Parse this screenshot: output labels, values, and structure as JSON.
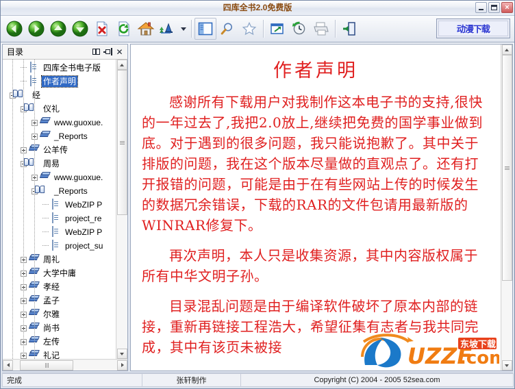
{
  "window": {
    "title": "四库全书2.0免费版",
    "minimize_label": "最小化",
    "maximize_label": "最大化",
    "close_label": "×"
  },
  "toolbar": {
    "buttons": [
      {
        "name": "back",
        "icon": "back-arrow-icon",
        "tooltip": "后退"
      },
      {
        "name": "forward",
        "icon": "forward-arrow-icon",
        "tooltip": "前进"
      },
      {
        "name": "up",
        "icon": "up-arrow-icon",
        "tooltip": "上一个"
      },
      {
        "name": "down",
        "icon": "down-arrow-icon",
        "tooltip": "下一个"
      },
      {
        "name": "stop",
        "icon": "stop-page-icon",
        "tooltip": "停止"
      },
      {
        "name": "refresh",
        "icon": "refresh-icon",
        "tooltip": "刷新"
      },
      {
        "name": "home",
        "icon": "home-icon",
        "tooltip": "主页"
      },
      {
        "name": "font",
        "icon": "font-size-icon",
        "tooltip": "字体"
      },
      {
        "name": "font-dropdown",
        "icon": "chevron-down-icon",
        "tooltip": "更多"
      },
      {
        "name": "contents",
        "icon": "contents-panel-icon",
        "tooltip": "目录"
      },
      {
        "name": "search",
        "icon": "magnifier-icon",
        "tooltip": "搜索"
      },
      {
        "name": "favorites",
        "icon": "star-icon",
        "tooltip": "收藏"
      },
      {
        "name": "open-window",
        "icon": "open-in-window-icon",
        "tooltip": "新窗口"
      },
      {
        "name": "history",
        "icon": "history-clock-icon",
        "tooltip": "历史"
      },
      {
        "name": "print",
        "icon": "printer-icon",
        "tooltip": "打印"
      },
      {
        "name": "exit",
        "icon": "exit-door-icon",
        "tooltip": "退出"
      }
    ],
    "download_button_label": "动漫下载"
  },
  "sidebar": {
    "panel_title": "目录",
    "header_buttons": [
      {
        "name": "dock-layout",
        "icon": "split-panel-icon"
      },
      {
        "name": "auto-hide",
        "icon": "pin-icon"
      },
      {
        "name": "close-panel",
        "icon": "close-icon",
        "label": "✕"
      }
    ],
    "tree": [
      {
        "label": "四库全书电子版",
        "depth": 1,
        "icon": "page-icon",
        "expander": "none",
        "selected": false
      },
      {
        "label": "作者声明",
        "depth": 1,
        "icon": "page-icon",
        "expander": "none",
        "selected": true
      },
      {
        "label": "经",
        "depth": 0,
        "icon": "openbook-icon",
        "expander": "minus",
        "selected": false
      },
      {
        "label": "仪礼",
        "depth": 1,
        "icon": "openbook-icon",
        "expander": "minus",
        "selected": false
      },
      {
        "label": "www.guoxue.",
        "depth": 2,
        "icon": "book-icon",
        "expander": "plus",
        "selected": false
      },
      {
        "label": "_Reports",
        "depth": 2,
        "icon": "book-icon",
        "expander": "plus",
        "selected": false
      },
      {
        "label": "公羊传",
        "depth": 1,
        "icon": "book-icon",
        "expander": "plus",
        "selected": false
      },
      {
        "label": "周易",
        "depth": 1,
        "icon": "openbook-icon",
        "expander": "minus",
        "selected": false
      },
      {
        "label": "www.guoxue.",
        "depth": 2,
        "icon": "book-icon",
        "expander": "plus",
        "selected": false
      },
      {
        "label": "_Reports",
        "depth": 2,
        "icon": "openbook-icon",
        "expander": "minus",
        "selected": false
      },
      {
        "label": "WebZIP P",
        "depth": 3,
        "icon": "page-icon",
        "expander": "none",
        "selected": false
      },
      {
        "label": "project_re",
        "depth": 3,
        "icon": "page-icon",
        "expander": "none",
        "selected": false
      },
      {
        "label": "WebZIP P",
        "depth": 3,
        "icon": "page-icon",
        "expander": "none",
        "selected": false
      },
      {
        "label": "project_su",
        "depth": 3,
        "icon": "page-icon",
        "expander": "none",
        "selected": false
      },
      {
        "label": "周礼",
        "depth": 1,
        "icon": "book-icon",
        "expander": "plus",
        "selected": false
      },
      {
        "label": "大学中庸",
        "depth": 1,
        "icon": "book-icon",
        "expander": "plus",
        "selected": false
      },
      {
        "label": "孝经",
        "depth": 1,
        "icon": "book-icon",
        "expander": "plus",
        "selected": false
      },
      {
        "label": "孟子",
        "depth": 1,
        "icon": "book-icon",
        "expander": "plus",
        "selected": false
      },
      {
        "label": "尔雅",
        "depth": 1,
        "icon": "book-icon",
        "expander": "plus",
        "selected": false
      },
      {
        "label": "尚书",
        "depth": 1,
        "icon": "book-icon",
        "expander": "plus",
        "selected": false
      },
      {
        "label": "左传",
        "depth": 1,
        "icon": "book-icon",
        "expander": "plus",
        "selected": false
      },
      {
        "label": "礼记",
        "depth": 1,
        "icon": "book-icon",
        "expander": "plus",
        "selected": false
      }
    ]
  },
  "document": {
    "title": "作者声明",
    "paragraphs": [
      "感谢所有下载用户对我制作这本电子书的支持,很快的一年过去了,我把2.0放上,继续把免费的国学事业做到底。对于遇到的很多问题，我只能说抱歉了。其中关于排版的问题，我在这个版本尽量做的直观点了。还有打开报错的问题，可能是由于在有些网站上传的时候发生的数据冗余错误，下载的RAR的文件包请用最新版的WINRAR修复下。",
      "再次声明，本人只是收集资源，其中内容版权属于所有中华文明子孙。",
      "目录混乱问题是由于编译软件破坏了原本内部的链接，重新再链接工程浩大，希望征集有志者与我共同完成，其中有该页未被接"
    ],
    "watermark_text": "UZZF.com",
    "watermark_badge": "东坡下载"
  },
  "status_bar": {
    "left": "完成",
    "center": "张轩制作",
    "right": "Copyright (C) 2004 - 2005 52sea.com"
  },
  "colors": {
    "title_text": "#8a4b10",
    "doc_text": "#e02020",
    "selection": "#316ac5",
    "download_text": "#2a35d0"
  }
}
